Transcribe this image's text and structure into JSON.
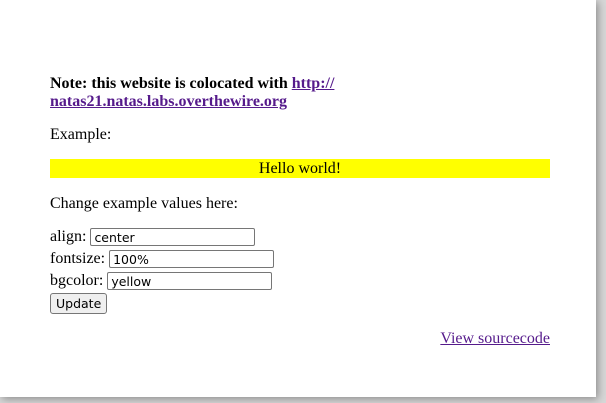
{
  "note": {
    "prefix": "Note: this website is colocated with ",
    "link_text": "http://\nnatas21.natas.labs.overthewire.org"
  },
  "example": {
    "label": "Example:",
    "text": "Hello world!",
    "bgcolor": "#ffff00"
  },
  "form": {
    "heading": "Change example values here:",
    "fields": [
      {
        "label": "align:",
        "value": "center"
      },
      {
        "label": "fontsize:",
        "value": "100%"
      },
      {
        "label": "bgcolor:",
        "value": "yellow"
      }
    ],
    "submit_label": "Update"
  },
  "footer": {
    "source_link": "View sourcecode"
  },
  "colors": {
    "link_visited": "#551a8b",
    "highlight": "#ffff00"
  }
}
